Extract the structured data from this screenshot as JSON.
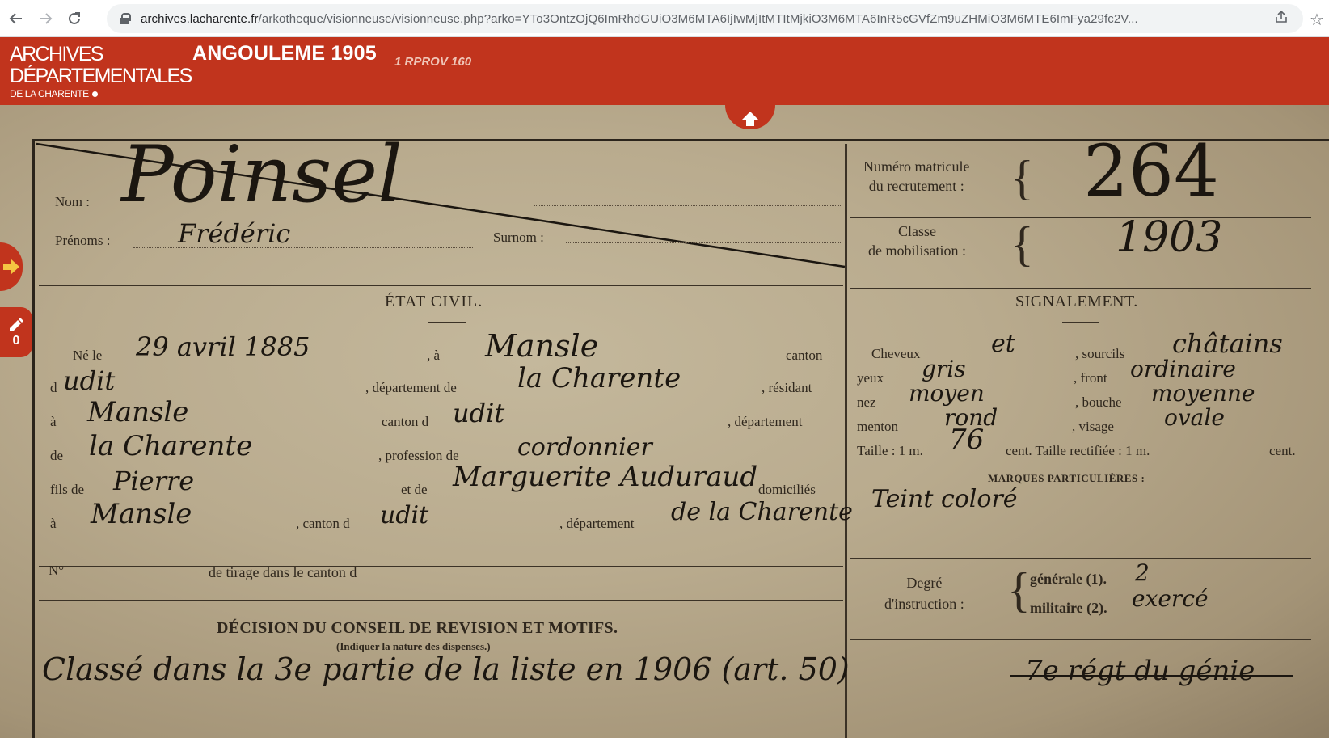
{
  "browser": {
    "url_host": "archives.lacharente.fr",
    "url_path": "/arkotheque/visionneuse/visionneuse.php?arko=YTo3OntzOjQ6ImRhdGUiO3M6MTA6IjIwMjItMTItMjkiO3M6MTA6InR5cGVfZm9uZHMiO3M6MTE6ImFya29fc2V..."
  },
  "header": {
    "logo_line1": "ARCHIVES",
    "logo_line2": "DÉPARTEMENTALES",
    "logo_line3": "DE LA CHARENTE",
    "title": "ANGOULEME 1905",
    "cote": "1 RPROV 160"
  },
  "side": {
    "note_count": "0"
  },
  "document": {
    "printed": {
      "nom": "Nom :",
      "prenoms": "Prénoms :",
      "surnom": "Surnom :",
      "matricule_1": "Numéro matricule",
      "matricule_2": "du recrutement :",
      "classe_1": "Classe",
      "classe_2": "de mobilisation :",
      "etat_civil": "ÉTAT CIVIL.",
      "signalement": "SIGNALEMENT.",
      "ne_le": "Né le",
      "a": ", à",
      "canton": "canton",
      "d": "d",
      "departement_de": ", département de",
      "residant": ", résidant",
      "a2": "à",
      "canton_d": "canton d",
      "departement": ", département",
      "de": "de",
      "profession_de": ", profession de",
      "fils_de": "fils de",
      "et_de": "et de",
      "domicilies": "domiciliés",
      "a3": "à",
      "canton_d2": ", canton d",
      "departement_de2": ", département",
      "cheveux": "Cheveux",
      "sourcils": ", sourcils",
      "yeux": "yeux",
      "front": ", front",
      "nez": "nez",
      "bouche": ", bouche",
      "menton": "menton",
      "visage": ", visage",
      "taille": "Taille : 1 m.",
      "cent_taille": "cent. Taille rectifiée : 1 m.",
      "cent": "cent.",
      "marques": "MARQUES PARTICULIÈRES :",
      "no": "N°",
      "tirage": "de tirage dans le canton d",
      "degre_1": "Degré",
      "degre_2": "d'instruction :",
      "generale": "générale (1).",
      "militaire": "militaire (2).",
      "decision": "DÉCISION DU CONSEIL DE REVISION ET MOTIFS.",
      "decision_sub": "(Indiquer la nature des dispenses.)"
    },
    "handwritten": {
      "nom": "Poinsel",
      "prenoms": "Frédéric",
      "matricule": "264",
      "classe": "1903",
      "date_naissance": "29 avril 1885",
      "lieu": "Mansle",
      "canton": "udit",
      "departement": "la Charente",
      "residant_lieu": "Mansle",
      "residant_canton": "udit",
      "residant_dept": "la Charente",
      "profession": "cordonnier",
      "pere": "Pierre",
      "mere": "Marguerite Auduraud",
      "domicile": "Mansle",
      "domicile_canton": "udit",
      "domicile_dept": "de la Charente",
      "cheveux": "et",
      "sourcils": "châtains",
      "yeux": "gris",
      "front": "ordinaire",
      "nez": "moyen",
      "bouche": "moyenne",
      "menton": "rond",
      "visage": "ovale",
      "taille_cm": "76",
      "marques": "Teint coloré",
      "instruction_generale": "2",
      "instruction_militaire": "exercé",
      "decision": "Classé dans la 3e partie de la liste en 1906 (art. 50)",
      "affectation": "7e régt du génie"
    }
  }
}
